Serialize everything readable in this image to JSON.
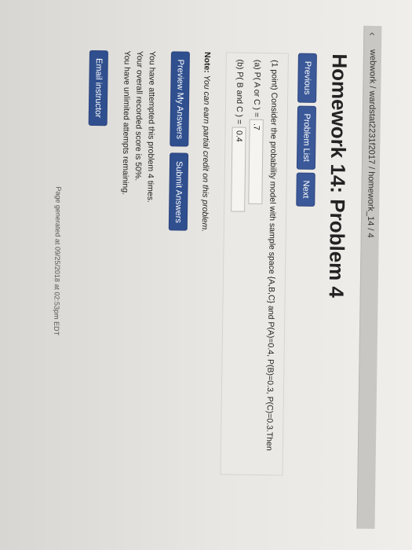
{
  "header": {
    "back_glyph": "‹",
    "breadcrumb": "webwork / wardstat2231f2017 / homework_14 / 4"
  },
  "title": "Homework 14: Problem 4",
  "nav": {
    "previous": "Previous",
    "problem_list": "Problem List",
    "next": "Next"
  },
  "problem": {
    "statement": "(1 point) Consider the probability model with sample space {A,B,C} and P(A)=0.4, P(B)=0.3, P(C)=0.3.Then",
    "part_a_label": "(a) P( A or C ) =",
    "part_a_value": ".7",
    "part_b_label": "(b) P( B and C ) =",
    "part_b_value": "0.4"
  },
  "note": {
    "label": "Note:",
    "text": "You can earn partial credit on this problem."
  },
  "actions": {
    "preview": "Preview My Answers",
    "submit": "Submit Answers"
  },
  "status": {
    "line1": "You have attempted this problem 4 times.",
    "line2": "Your overall recorded score is 50%.",
    "line3": "You have unlimited attempts remaining."
  },
  "email_button": "Email instructor",
  "footer": "Page generated at 09/25/2018 at 02:53pm EDT",
  "colors": {
    "button": "#3b5998",
    "background": "#e9e7e3"
  }
}
